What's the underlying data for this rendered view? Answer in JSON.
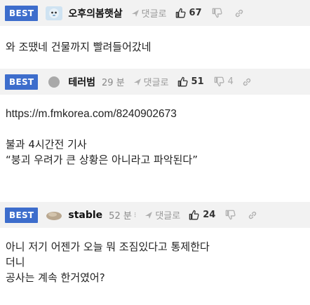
{
  "comments": [
    {
      "badge": "BEST",
      "nickname": "오후의봄햇살",
      "time": "",
      "reply_label": "댓글로",
      "upvotes": "67",
      "downvotes": "",
      "lines": [
        "와 조땠네 건물까지 빨려들어갔네"
      ]
    },
    {
      "badge": "BEST",
      "nickname": "테러범",
      "time": "29 분",
      "reply_label": "댓글로",
      "upvotes": "51",
      "downvotes": "4",
      "url": "https://m.fmkorea.com/8240902673",
      "lines": [
        "불과 4시간전 기사",
        "“붕괴 우려가 큰 상황은 아니라고 파악된다”"
      ]
    },
    {
      "badge": "BEST",
      "nickname": "stable",
      "time": "52 분",
      "reply_label": "댓글로",
      "upvotes": "24",
      "downvotes": "",
      "lines": [
        "아니 저기 어젠가 오늘 뭐 조짐있다고 통제한다",
        "더니",
        "공사는 계속 한거였어?"
      ]
    }
  ],
  "colors": {
    "best_badge": "#3d6dcc",
    "meta_bg": "#f2f2f2"
  },
  "icons": {
    "reply": "reply-arrow-icon",
    "upvote": "thumbs-up-icon",
    "downvote": "thumbs-down-icon",
    "link": "link-icon"
  }
}
